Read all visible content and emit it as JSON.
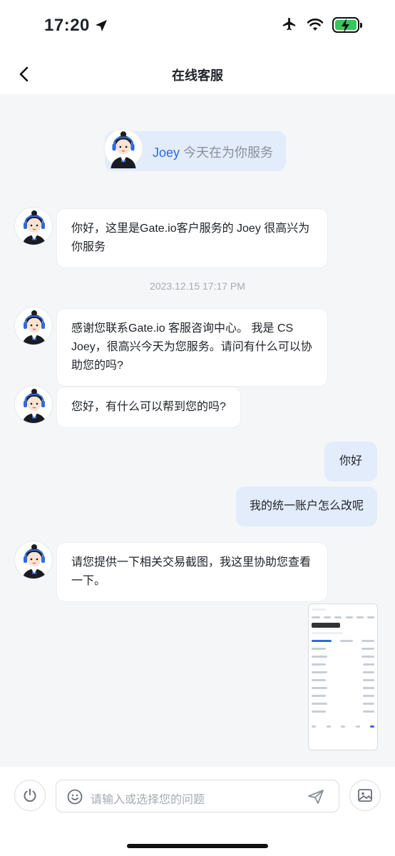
{
  "status_bar": {
    "time": "17:20"
  },
  "nav": {
    "title": "在线客服"
  },
  "agent_header": {
    "name": "Joey",
    "text": " 今天在为你服务"
  },
  "timestamp": "2023.12.15 17:17 PM",
  "messages": [
    {
      "from": "agent",
      "text": "你好，这里是Gate.io客户服务的 Joey 很高兴为你服务"
    },
    {
      "from": "agent",
      "text": "感谢您联系Gate.io 客服咨询中心。 我是 CS Joey，很高兴今天为您服务。请问有什么可以协助您的吗?"
    },
    {
      "from": "agent",
      "text": "您好，有什么可以帮到您的吗?"
    },
    {
      "from": "user",
      "text": "你好"
    },
    {
      "from": "user",
      "text": "我的统一账户怎么改呢"
    },
    {
      "from": "agent",
      "text": "请您提供一下相关交易截图，我这里协助您查看一下。"
    }
  ],
  "input": {
    "placeholder": "请输入或选择您的问题"
  },
  "colors": {
    "accent": "#2F6BDE",
    "user_bubble": "#E3ECFB",
    "background": "#F5F6F8"
  }
}
